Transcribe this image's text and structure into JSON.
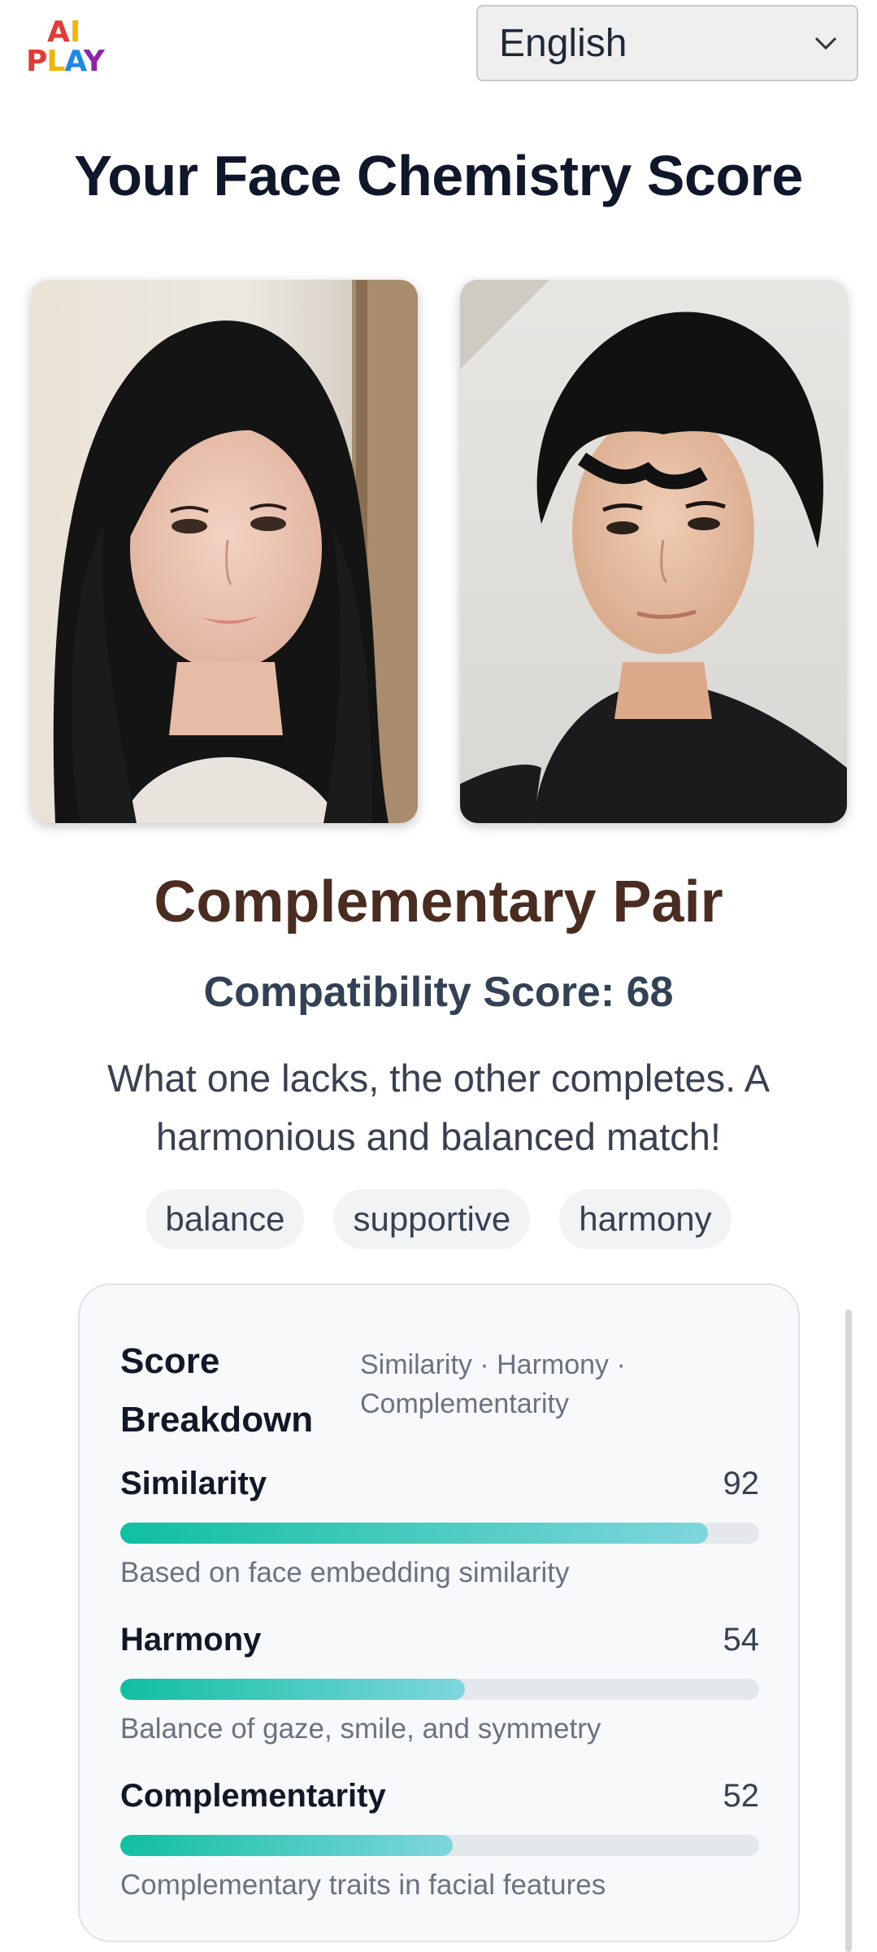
{
  "header": {
    "logo": {
      "line1": "AI",
      "line2": "PLAY"
    },
    "language": {
      "selected": "English",
      "icon": "chevron-down-icon"
    }
  },
  "page_title": "Your Face Chemistry Score",
  "photos": [
    {
      "description_icon": "woman-portrait-photo"
    },
    {
      "description_icon": "man-portrait-photo"
    }
  ],
  "result": {
    "title": "Complementary Pair",
    "score_text": "Compatibility Score: 68",
    "description": "What one lacks, the other completes. A harmonious and balanced match!",
    "tags": [
      "balance",
      "supportive",
      "harmony"
    ]
  },
  "breakdown": {
    "title": "Score Breakdown",
    "subtitle": "Similarity · Harmony · Complementarity",
    "metrics": [
      {
        "name": "Similarity",
        "value": "92",
        "percent": 92,
        "note": "Based on face embedding similarity"
      },
      {
        "name": "Harmony",
        "value": "54",
        "percent": 54,
        "note": "Balance of gaze, smile, and symmetry"
      },
      {
        "name": "Complementarity",
        "value": "52",
        "percent": 52,
        "note": "Complementary traits in facial features"
      }
    ]
  },
  "colors": {
    "title": "#0f172a",
    "result_title": "#4a2c21",
    "bar_start": "#10bfa1",
    "bar_end": "#7fd6dd",
    "track": "#e4e7eb"
  }
}
